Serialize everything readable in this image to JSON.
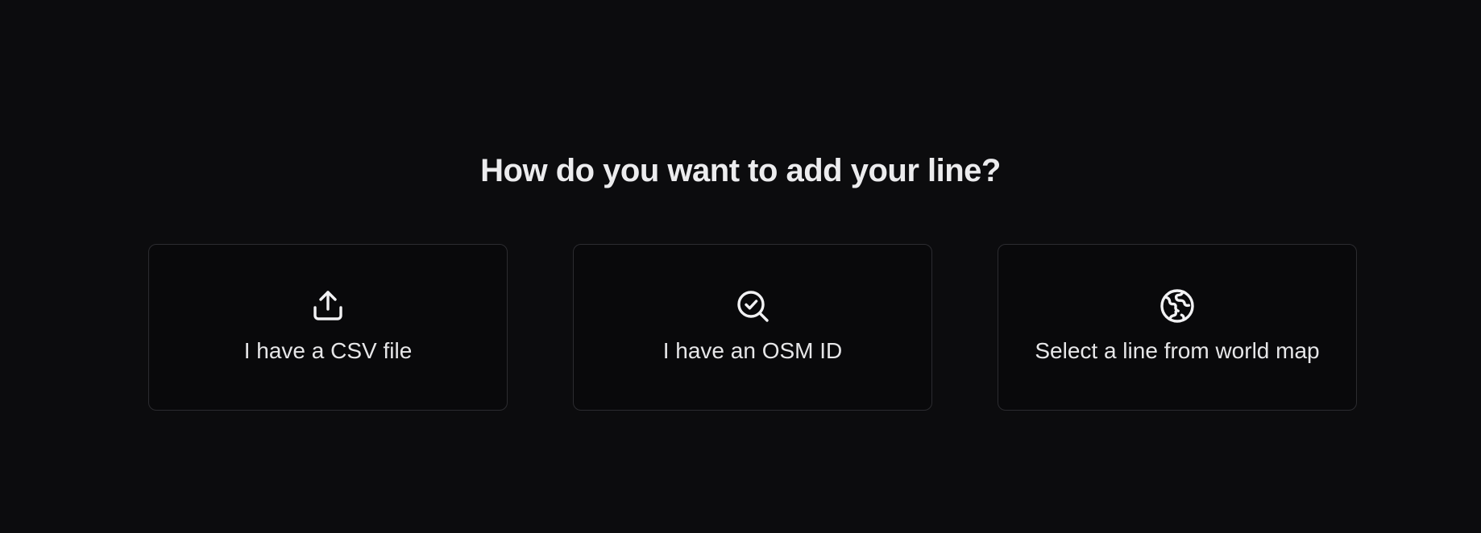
{
  "heading": "How do you want to add your line?",
  "options": [
    {
      "label": "I have a CSV file",
      "icon": "upload-icon"
    },
    {
      "label": "I have an OSM ID",
      "icon": "search-check-icon"
    },
    {
      "label": "Select a line from world map",
      "icon": "globe-icon"
    }
  ],
  "colors": {
    "background": "#0c0c0e",
    "card_background": "#09090b",
    "card_border": "#2c2c30",
    "text": "#ececee"
  }
}
